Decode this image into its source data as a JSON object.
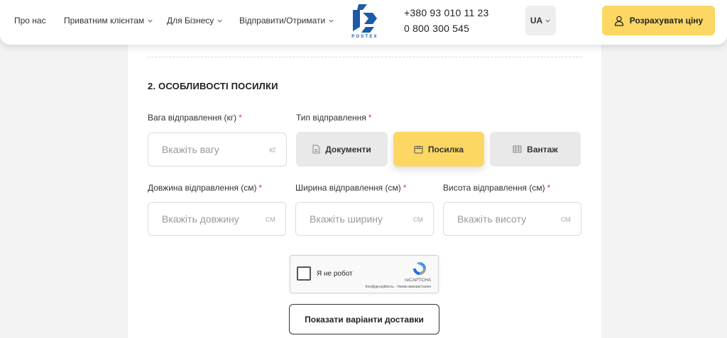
{
  "header": {
    "nav": [
      "Про нас",
      "Приватним клієнтам",
      "Для Бізнесу",
      "Відправити/Отримати"
    ],
    "logo_text": "POSTEX",
    "phones": [
      "+380 93 010 11 23",
      "0 800 300 545"
    ],
    "language": "UA",
    "cta_label": "Розрахувати ціну"
  },
  "form": {
    "section_title": "2. ОСОБЛИВОСТІ ПОСИЛКИ",
    "required_mark": "*",
    "weight": {
      "label": "Вага відправлення (кг)",
      "placeholder": "Вкажіть вагу",
      "unit": "кг"
    },
    "type": {
      "label": "Тип відправлення",
      "options": [
        "Документи",
        "Посилка",
        "Вантаж"
      ],
      "selected": "Посилка"
    },
    "length": {
      "label": "Довжина відправлення (см)",
      "placeholder": "Вкажіть довжину",
      "unit": "см"
    },
    "width": {
      "label": "Ширина відправлення (см)",
      "placeholder": "Вкажіть ширину",
      "unit": "см"
    },
    "height": {
      "label": "Висота відправлення (см)",
      "placeholder": "Вкажіть висоту",
      "unit": "см"
    },
    "recaptcha": {
      "text": "Я не робот",
      "brand": "reCAPTCHA",
      "links": "Конфіденційність - Умови використання"
    },
    "submit_label": "Показати варіанти доставки"
  },
  "colors": {
    "accent": "#fdd763",
    "required": "#e53935",
    "logo": "#1e5aa8"
  }
}
